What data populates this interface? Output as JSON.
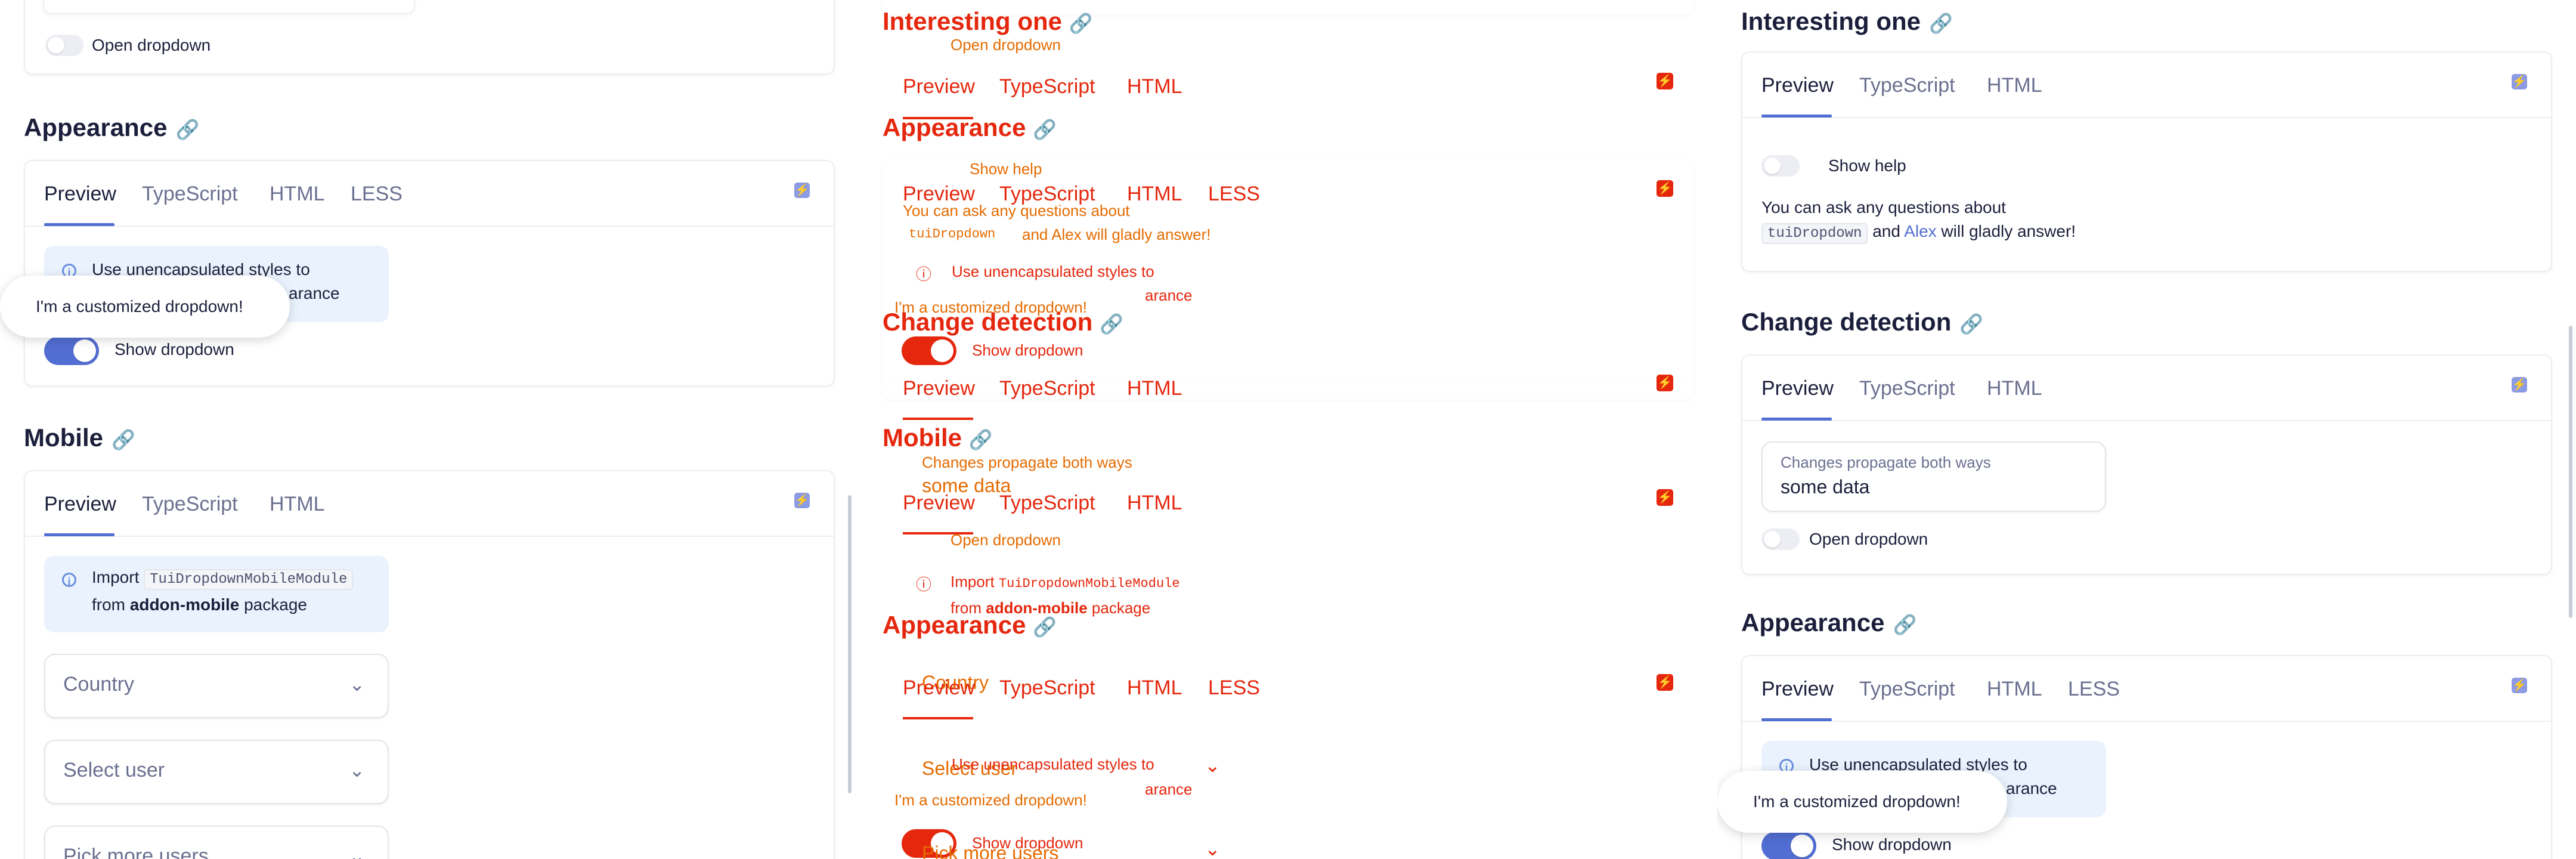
{
  "tabs": {
    "preview": "Preview",
    "typescript": "TypeScript",
    "html": "HTML",
    "less": "LESS"
  },
  "headings": {
    "interesting": "Interesting one",
    "appearance": "Appearance",
    "mobile": "Mobile",
    "change_detection": "Change detection"
  },
  "labels": {
    "open_dropdown": "Open dropdown",
    "show_dropdown": "Show dropdown",
    "show_help": "Show help",
    "custom_popup": "I'm a customized dropdown!",
    "unencap_line1": "Use unencapsulated styles to",
    "unencap_line2": "arance",
    "help_line1": "You can ask any questions about",
    "help_code": "tuiDropdown",
    "help_and": "and",
    "help_alex": "Alex",
    "help_tail": "will gladly answer!",
    "import_word": "Import",
    "import_code": "TuiDropdownMobileModule",
    "from_word": "from",
    "addon": "addon-mobile",
    "package_word": "package",
    "country": "Country",
    "select_user": "Select user",
    "pick_more": "Pick more users",
    "changes_label": "Changes propagate both ways",
    "some_data": "some data"
  },
  "colors": {
    "accent": "#526ed3",
    "overlay_red": "#e5270e",
    "overlay_orange": "#e56b00"
  }
}
